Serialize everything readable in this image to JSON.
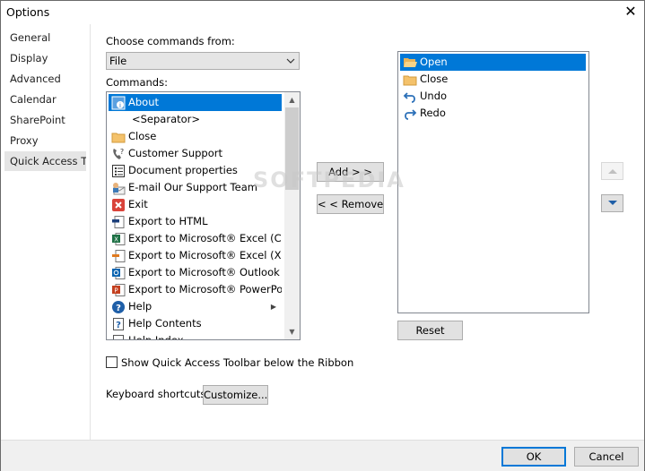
{
  "window": {
    "title": "Options"
  },
  "sidebar": {
    "items": [
      {
        "label": "General"
      },
      {
        "label": "Display"
      },
      {
        "label": "Advanced"
      },
      {
        "label": "Calendar"
      },
      {
        "label": "SharePoint"
      },
      {
        "label": "Proxy"
      },
      {
        "label": "Quick Access T...",
        "selected": true
      }
    ]
  },
  "commands_from": {
    "label": "Choose commands from:",
    "value": "File"
  },
  "commands": {
    "label": "Commands:",
    "items": [
      {
        "label": "About",
        "icon": "about-icon",
        "selected": true
      },
      {
        "label": "<Separator>",
        "icon": ""
      },
      {
        "label": "Close",
        "icon": "folder-icon"
      },
      {
        "label": "Customer Support",
        "icon": "phone-question-icon"
      },
      {
        "label": "Document properties",
        "icon": "properties-icon"
      },
      {
        "label": "E-mail Our Support Team",
        "icon": "email-icon"
      },
      {
        "label": "Exit",
        "icon": "exit-icon"
      },
      {
        "label": "Export to HTML",
        "icon": "html-export-icon"
      },
      {
        "label": "Export to Microsoft® Excel (CSV)",
        "icon": "excel-icon"
      },
      {
        "label": "Export to Microsoft® Excel (XML)",
        "icon": "excel-xml-icon"
      },
      {
        "label": "Export to Microsoft® Outlook",
        "icon": "outlook-icon"
      },
      {
        "label": "Export to Microsoft® PowerPoint",
        "icon": "powerpoint-icon"
      },
      {
        "label": "Help",
        "icon": "help-icon",
        "submenu": true
      },
      {
        "label": "Help Contents",
        "icon": "help-contents-icon"
      },
      {
        "label": "Help Index",
        "icon": "help-index-icon"
      }
    ]
  },
  "buttons": {
    "add": "Add > >",
    "remove": "< < Remove",
    "reset": "Reset",
    "customize": "Customize...",
    "ok": "OK",
    "cancel": "Cancel"
  },
  "toolbar_list": {
    "items": [
      {
        "label": "Open",
        "icon": "open-folder-icon",
        "selected": true
      },
      {
        "label": "Close",
        "icon": "folder-icon"
      },
      {
        "label": "Undo",
        "icon": "undo-icon"
      },
      {
        "label": "Redo",
        "icon": "redo-icon"
      }
    ]
  },
  "options": {
    "show_below_ribbon": {
      "label": "Show Quick Access Toolbar below the Ribbon",
      "checked": false
    },
    "keyboard_shortcuts_label": "Keyboard shortcuts:"
  },
  "watermark": "SOFTPEDIA",
  "colors": {
    "selection": "#0078d7",
    "footer": "#f0f0f0",
    "button": "#e1e1e1"
  }
}
